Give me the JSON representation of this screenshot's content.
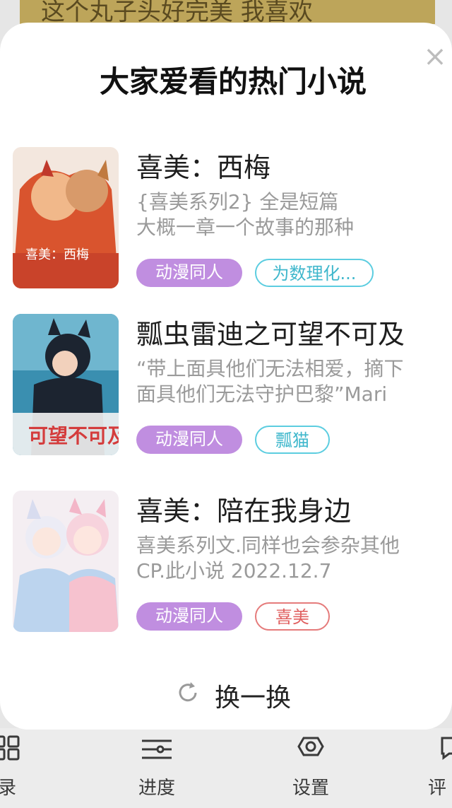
{
  "background": {
    "banner_text": "这个丸子头好完美 我喜欢",
    "nav": [
      {
        "label": "录",
        "icon": "grid-icon"
      },
      {
        "label": "进度",
        "icon": "sliders-icon"
      },
      {
        "label": "设置",
        "icon": "gear-icon"
      },
      {
        "label": "评",
        "icon": "comment-icon"
      }
    ]
  },
  "modal": {
    "title": "大家爱看的热门小说",
    "close_label": "×",
    "refresh_label": "换一换",
    "books": [
      {
        "title": "喜美：西梅",
        "desc_line1": "{喜美系列2} 全是短篇",
        "desc_line2": "大概一章一个故事的那种",
        "category": "动漫同人",
        "tag": "为数理化...",
        "cover_text": "喜美：西梅"
      },
      {
        "title": "瓢虫雷迪之可望不可及",
        "desc_line1": "“带上面具他们无法相爱，摘下",
        "desc_line2": "面具他们无法守护巴黎”Mari",
        "category": "动漫同人",
        "tag": "瓢猫",
        "cover_text": "可望不可及"
      },
      {
        "title": "喜美：陪在我身边",
        "desc_line1": "喜美系列文.同样也会参杂其他",
        "desc_line2": "CP.此小说 2022.12.7",
        "category": "动漫同人",
        "tag": "喜美"
      }
    ]
  },
  "colors": {
    "category_tag": "#c08ee0",
    "tag_blue": "#5ccde0",
    "tag_red": "#e57b7b"
  }
}
